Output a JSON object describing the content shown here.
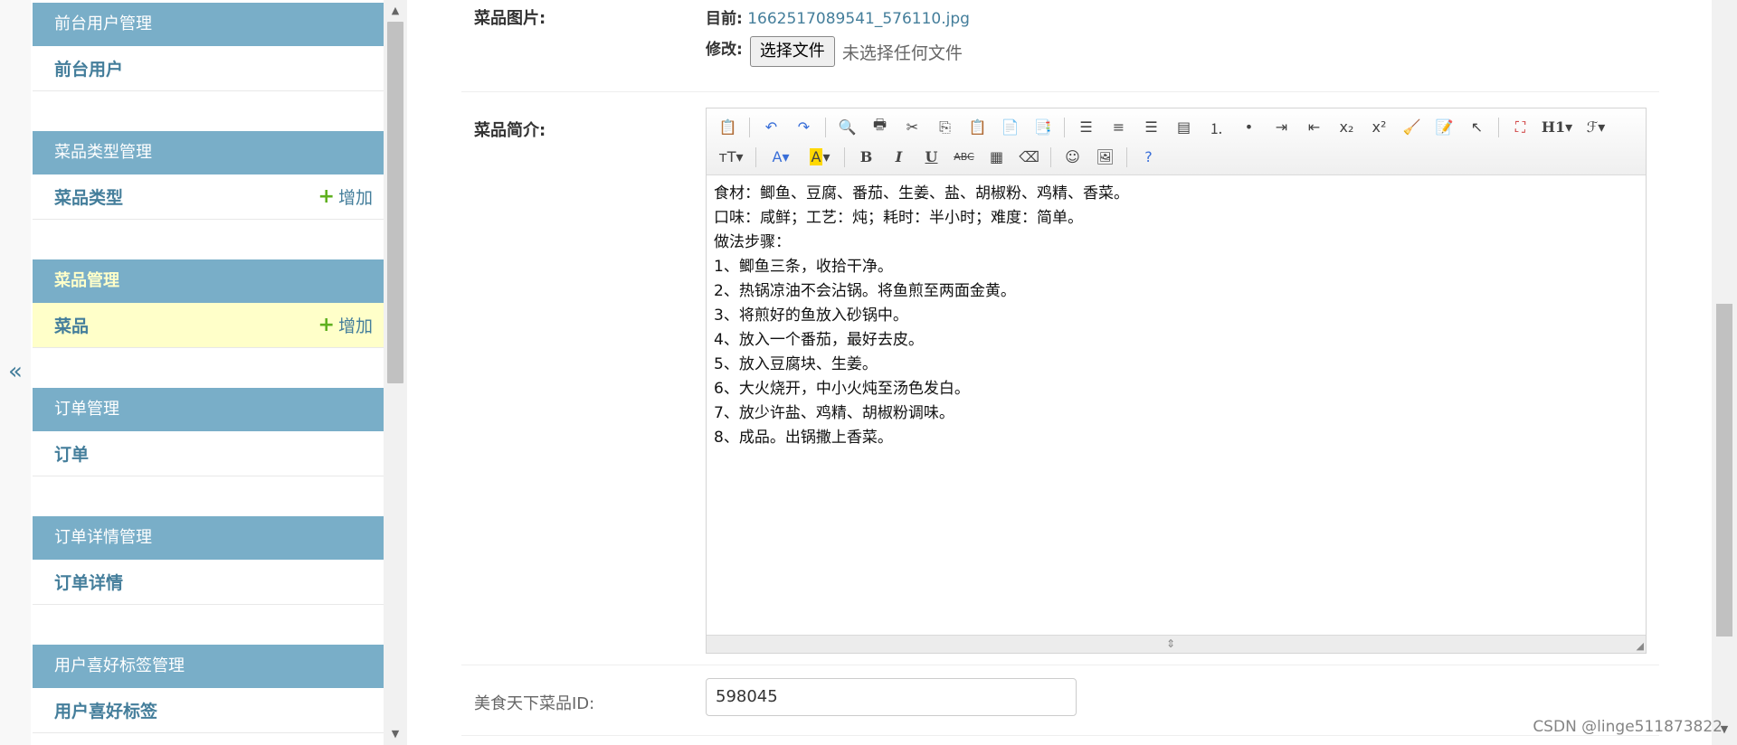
{
  "collapse_toggle": "«",
  "sidebar": {
    "modules": [
      {
        "caption": "前台用户管理",
        "link": "前台用户",
        "add": ""
      },
      {
        "caption": "菜品类型管理",
        "link": "菜品类型",
        "add": "增加"
      },
      {
        "caption": "菜品管理",
        "link": "菜品",
        "add": "增加",
        "active": true
      },
      {
        "caption": "订单管理",
        "link": "订单",
        "add": ""
      },
      {
        "caption": "订单详情管理",
        "link": "订单详情",
        "add": ""
      },
      {
        "caption": "用户喜好标签管理",
        "link": "用户喜好标签",
        "add": ""
      }
    ]
  },
  "form": {
    "image_field": {
      "label": "菜品图片:",
      "current_label": "目前:",
      "current_file": "1662517089541_576110.jpg",
      "change_label": "修改:",
      "choose_button": "选择文件",
      "no_file_text": "未选择任何文件"
    },
    "intro_field": {
      "label": "菜品简介:",
      "content": [
        "食材：鲫鱼、豆腐、番茄、生姜、盐、胡椒粉、鸡精、香菜。",
        "口味：咸鲜；工艺：炖；耗时：半小时；难度：简单。",
        "做法步骤：",
        "1、鲫鱼三条，收拾干净。",
        "2、热锅凉油不会沾锅。将鱼煎至两面金黄。",
        "3、将煎好的鱼放入砂锅中。",
        "4、放入一个番茄，最好去皮。",
        "5、放入豆腐块、生姜。",
        "6、大火烧开，中小火炖至汤色发白。",
        "7、放少许盐、鸡精、胡椒粉调味。",
        "8、成品。出锅撒上香菜。"
      ]
    },
    "id_field": {
      "label": "美食天下菜品ID:",
      "value": "598045"
    }
  },
  "toolbar": {
    "row1": [
      "paste-icon",
      "sep",
      "undo-icon",
      "redo-icon",
      "sep",
      "preview-icon",
      "print-icon",
      "cut-icon",
      "copy-icon",
      "paste-text-icon",
      "paste-plain-icon",
      "paste-word-icon",
      "sep",
      "align-left-icon",
      "align-center-icon",
      "align-right-icon",
      "align-justify-icon",
      "ordered-list-icon",
      "unordered-list-icon",
      "indent-icon",
      "outdent-icon",
      "subscript-icon",
      "superscript-icon",
      "clear-format-icon",
      "quick-format-icon",
      "select-all-icon",
      "sep",
      "fullscreen-icon",
      "heading-icon",
      "font-family-icon"
    ],
    "row2": [
      "font-size-icon",
      "sep",
      "font-color-icon",
      "highlight-color-icon",
      "sep",
      "bold-icon",
      "italic-icon",
      "underline-icon",
      "strikethrough-icon",
      "line-height-icon",
      "eraser-icon",
      "sep",
      "emoticon-icon",
      "image-icon",
      "sep",
      "help-icon"
    ],
    "heading_text": "H1",
    "bold_text": "B",
    "italic_text": "I",
    "underline_text": "U",
    "strike_text": "ABC"
  },
  "watermark": "CSDN @linge511873822",
  "colors": {
    "module_header": "#79aec8",
    "link": "#447e9b",
    "selected_row": "#ffffc9",
    "add_icon": "#5fb01f"
  }
}
